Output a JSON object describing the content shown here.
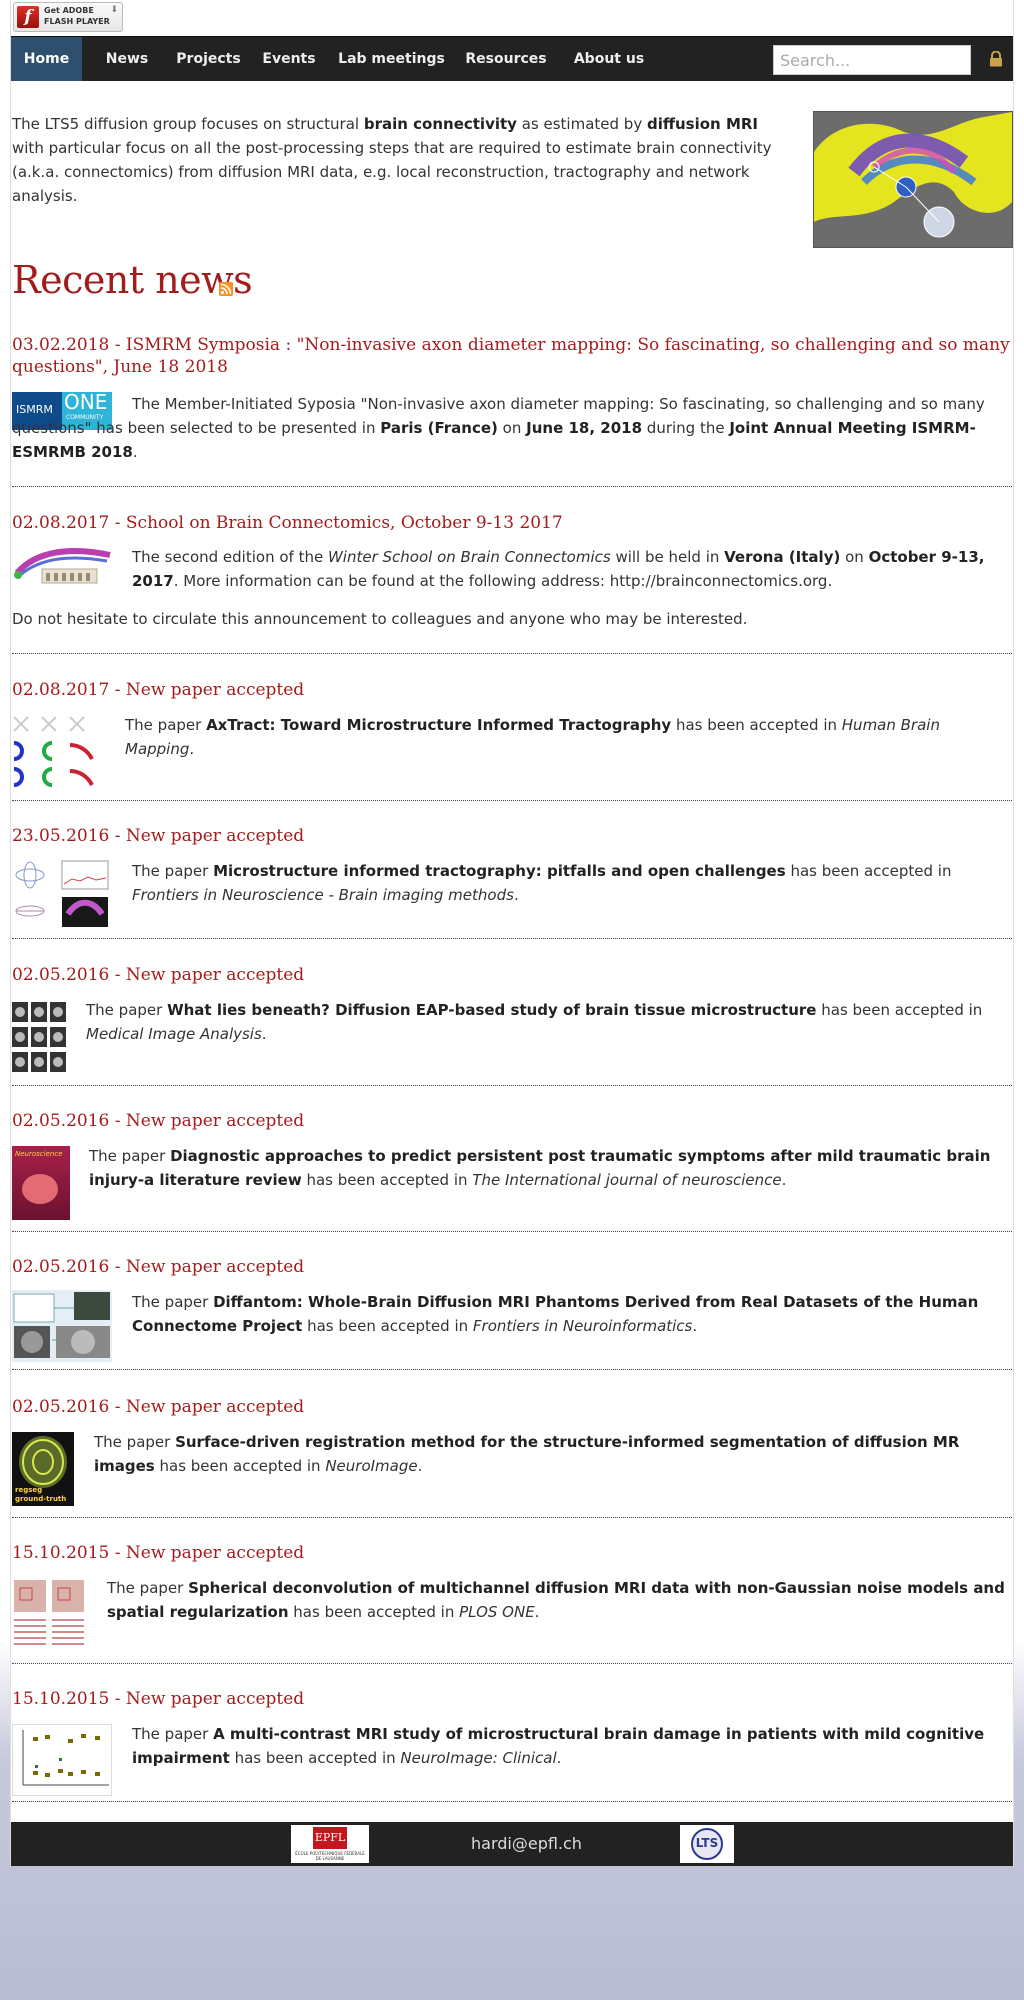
{
  "flash": {
    "line1": "Get ADOBE",
    "line2": "FLASH PLAYER",
    "logo_glyph": "f"
  },
  "nav": {
    "items": [
      "Home",
      "News",
      "Projects",
      "Events",
      "Lab meetings",
      "Resources",
      "About us"
    ],
    "active": "Home",
    "search_placeholder": "Search...",
    "lock_icon": "lock-icon"
  },
  "intro": {
    "t1": "The LTS5 diffusion group focuses on structural ",
    "b1": "brain connectivity",
    "t2": " as estimated by ",
    "b2": "diffusion MRI",
    "t3": " with particular focus on all the post-processing steps that are required to estimate brain connectivity (a.k.a. connectomics) from diffusion MRI data, e.g. local reconstruction, tractography and network analysis."
  },
  "news_heading": "Recent news",
  "news": [
    {
      "date": "03.02.2018",
      "title": "ISMRM Symposia : \"Non-invasive axon diameter mapping: So fascinating, so challenging and so many questions\", June 18 2018",
      "t1": "The Member-Initiated Syposia \"Non-invasive axon diameter mapping: So fascinating, so challenging and so many questions\" has been selected to be presented in ",
      "b1": "Paris (France)",
      "t2": " on ",
      "b2": "June 18, 2018",
      "t3": " during the ",
      "b3": "Joint Annual Meeting ISMRM-ESMRMB 2018",
      "t4": ".",
      "thumb_text1": "ISMRM",
      "thumb_text2": "ONE",
      "thumb_text3": "COMMUNITY"
    },
    {
      "date": "02.08.2017",
      "title": "School on Brain Connectomics, October 9-13 2017",
      "t1": "The second edition of the ",
      "i1": "Winter School on Brain Connectomics",
      "t2": " will be held in ",
      "b1": "Verona (Italy)",
      "t3": " on ",
      "b2": "October 9-13, 2017",
      "t4": ". More information can be found at the following address: http://brainconnectomics.org.",
      "p2": "Do not hesitate to circulate this announcement to colleagues and anyone who may be interested."
    },
    {
      "date": "02.08.2017",
      "title": "New paper accepted",
      "paper": "AxTract: Toward Microstructure Informed Tractography",
      "journal": "Human Brain Mapping"
    },
    {
      "date": "23.05.2016",
      "title": "New paper accepted",
      "paper": "Microstructure informed tractography: pitfalls and open challenges",
      "journal": "Frontiers in Neuroscience - Brain imaging methods"
    },
    {
      "date": "02.05.2016",
      "title": "New paper accepted",
      "paper": "What lies beneath? Diffusion EAP-based study of brain tissue microstructure",
      "journal": "Medical Image Analysis"
    },
    {
      "date": "02.05.2016",
      "title": "New paper accepted",
      "paper": "Diagnostic approaches to predict persistent post traumatic symptoms after mild traumatic brain injury-a literature review",
      "journal": "The International journal of neuroscience",
      "thumb_text": "Neuroscience"
    },
    {
      "date": "02.05.2016",
      "title": "New paper accepted",
      "paper": "Diffantom: Whole-Brain Diffusion MRI Phantoms Derived from Real Datasets of the Human Connectome Project",
      "journal": "Frontiers in Neuroinformatics"
    },
    {
      "date": "02.05.2016",
      "title": "New paper accepted",
      "paper": "Surface-driven registration method for the structure-informed segmentation of diffusion MR images",
      "journal": "NeuroImage",
      "thumb_text1": "regseg",
      "thumb_text2": "ground-truth"
    },
    {
      "date": "15.10.2015",
      "title": "New paper accepted",
      "paper": "Spherical deconvolution of multichannel diffusion MRI data with non-Gaussian noise models and spatial regularization",
      "journal": "PLOS ONE"
    },
    {
      "date": "15.10.2015",
      "title": "New paper accepted",
      "paper": "A multi-contrast MRI study of microstructural brain damage in patients with mild cognitive impairment",
      "journal": "NeuroImage: Clinical"
    }
  ],
  "sentence": {
    "pre": "The paper ",
    "mid": " has been accepted in ",
    "end": "."
  },
  "footer": {
    "email": "hardi@epfl.ch",
    "epfl_text": "EPFL",
    "epfl_sub": "ÉCOLE POLYTECHNIQUE FÉDÉRALE DE LAUSANNE",
    "lts_text": "LTS"
  },
  "colors": {
    "heading_red": "#a31b1b",
    "nav_bg": "#222222",
    "nav_active": "#2e4f6e",
    "rss": "#f39325"
  }
}
